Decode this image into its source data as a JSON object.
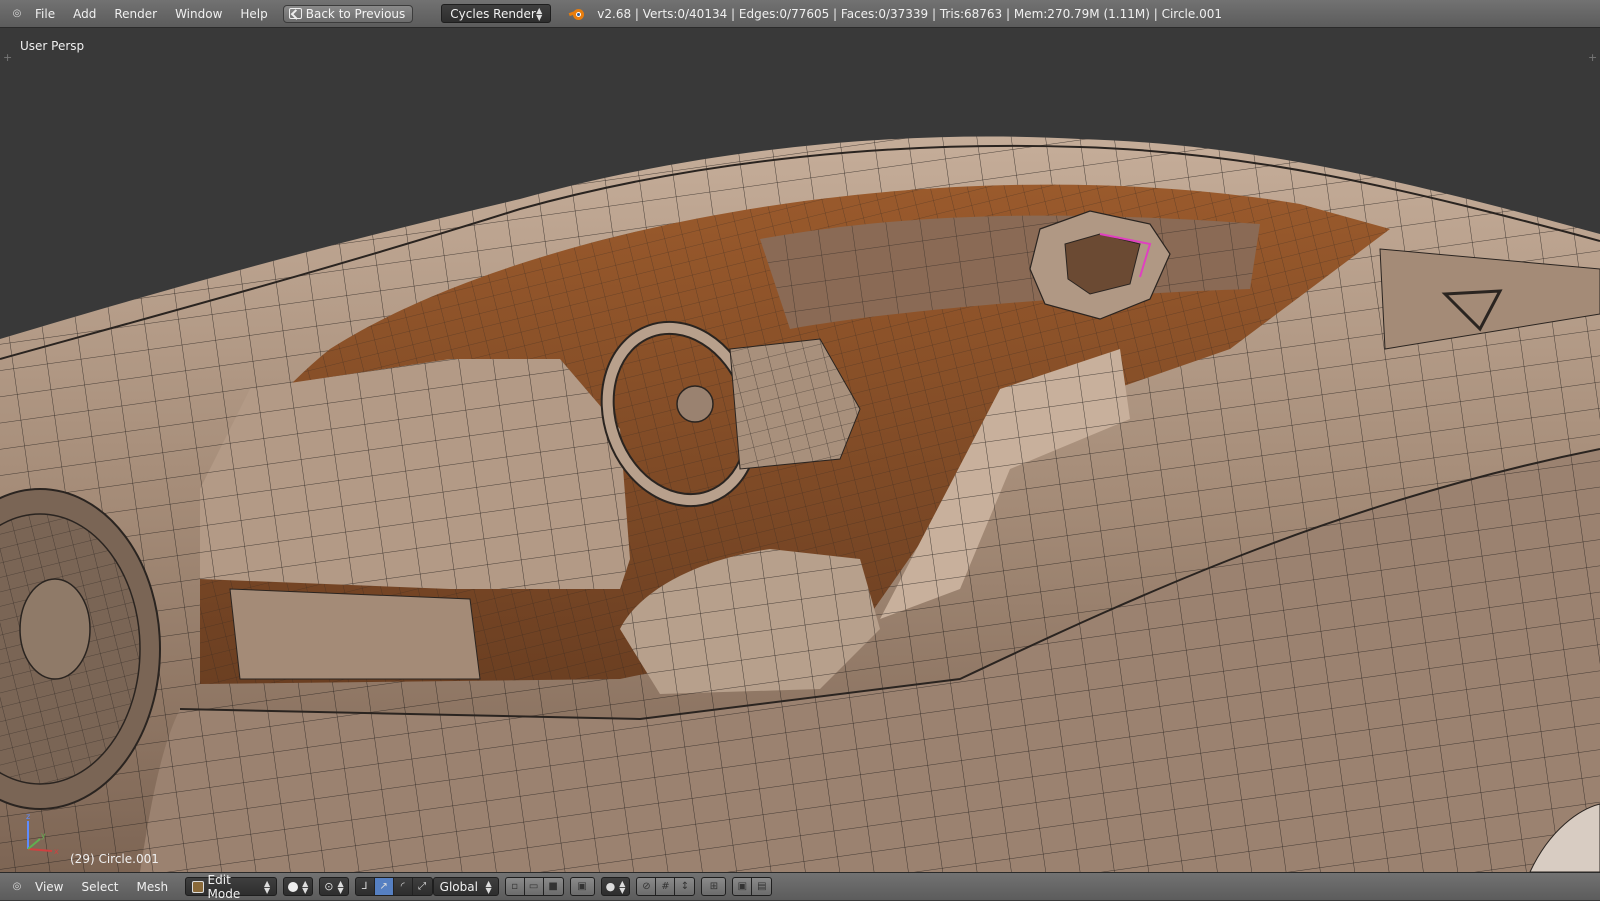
{
  "topbar": {
    "menu": [
      "File",
      "Add",
      "Render",
      "Window",
      "Help"
    ],
    "back_label": "Back to Previous",
    "render_engine": "Cycles Render",
    "stats": "v2.68 | Verts:0/40134 | Edges:0/77605 | Faces:0/37339 | Tris:68763 | Mem:270.79M (1.11M) | Circle.001"
  },
  "viewport": {
    "view_label": "User Persp",
    "object_label": "(29) Circle.001",
    "background": "#393939",
    "mesh_color": "#a48b77"
  },
  "bottombar": {
    "menu": [
      "View",
      "Select",
      "Mesh"
    ],
    "mode": "Edit Mode",
    "orientation": "Global"
  },
  "colors": {
    "header": "#636363",
    "accent": "#5680c2",
    "selection": "#e040c0",
    "blender_orange": "#e87d0d"
  }
}
